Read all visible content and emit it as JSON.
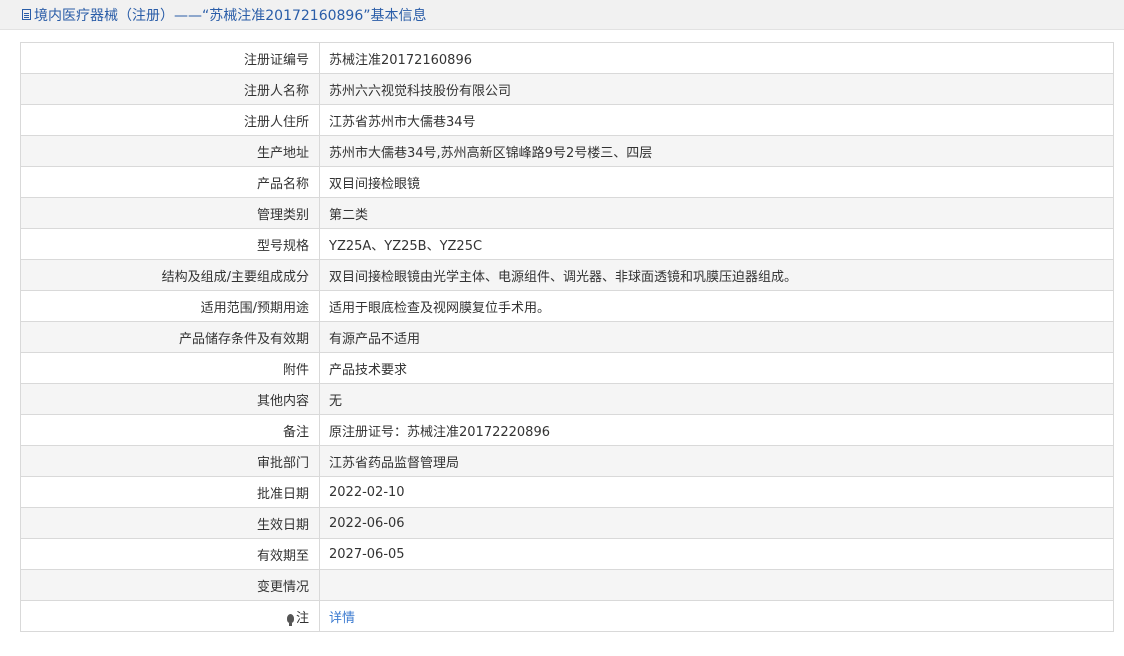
{
  "header": {
    "icon": "document-icon",
    "title": "境内医疗器械（注册）——“苏械注准20172160896”基本信息"
  },
  "rows": [
    {
      "label": "注册证编号",
      "value": "苏械注准20172160896"
    },
    {
      "label": "注册人名称",
      "value": "苏州六六视觉科技股份有限公司"
    },
    {
      "label": "注册人住所",
      "value": "江苏省苏州市大儒巷34号"
    },
    {
      "label": "生产地址",
      "value": "苏州市大儒巷34号,苏州高新区锦峰路9号2号楼三、四层"
    },
    {
      "label": "产品名称",
      "value": "双目间接检眼镜"
    },
    {
      "label": "管理类别",
      "value": "第二类"
    },
    {
      "label": "型号规格",
      "value": "YZ25A、YZ25B、YZ25C"
    },
    {
      "label": "结构及组成/主要组成成分",
      "value": "双目间接检眼镜由光学主体、电源组件、调光器、非球面透镜和巩膜压迫器组成。"
    },
    {
      "label": "适用范围/预期用途",
      "value": "适用于眼底检查及视网膜复位手术用。"
    },
    {
      "label": "产品储存条件及有效期",
      "value": "有源产品不适用"
    },
    {
      "label": "附件",
      "value": "产品技术要求"
    },
    {
      "label": "其他内容",
      "value": "无"
    },
    {
      "label": "备注",
      "value": "原注册证号：苏械注准20172220896"
    },
    {
      "label": "审批部门",
      "value": "江苏省药品监督管理局"
    },
    {
      "label": "批准日期",
      "value": "2022-02-10"
    },
    {
      "label": "生效日期",
      "value": "2022-06-06"
    },
    {
      "label": "有效期至",
      "value": "2027-06-05"
    },
    {
      "label": "变更情况",
      "value": ""
    }
  ],
  "note": {
    "icon": "lightbulb-icon",
    "label": "注",
    "link_text": "详情"
  },
  "colors": {
    "header_text": "#2a5da8",
    "link": "#3c7bd0",
    "stripe": "#f5f5f5",
    "border": "#d9d9d9"
  }
}
